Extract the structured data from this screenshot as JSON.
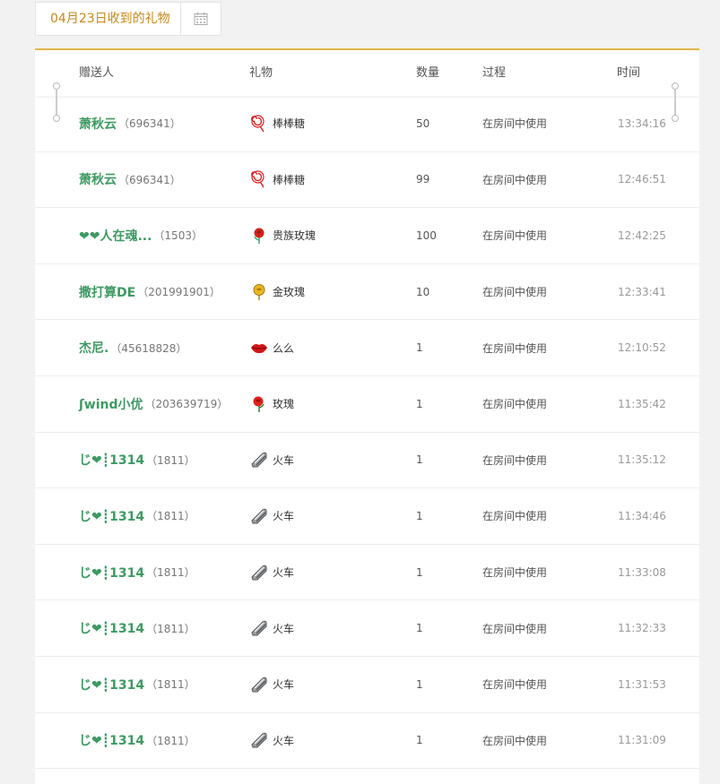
{
  "date_picker": {
    "label": "04月23日收到的礼物"
  },
  "table": {
    "headers": {
      "sender": "赠送人",
      "gift": "礼物",
      "quantity": "数量",
      "process": "过程",
      "time": "时间"
    },
    "rows": [
      {
        "sender_name": "萧秋云",
        "sender_id": "（696341）",
        "gift_icon": "lollipop-icon",
        "gift": "棒棒糖",
        "quantity": "50",
        "process": "在房间中使用",
        "time": "13:34:16"
      },
      {
        "sender_name": "萧秋云",
        "sender_id": "（696341）",
        "gift_icon": "lollipop-icon",
        "gift": "棒棒糖",
        "quantity": "99",
        "process": "在房间中使用",
        "time": "12:46:51"
      },
      {
        "sender_name": "❤❤人在魂...",
        "sender_id": "（1503）",
        "gift_icon": "red-rose-icon",
        "gift": "贵族玫瑰",
        "quantity": "100",
        "process": "在房间中使用",
        "time": "12:42:25"
      },
      {
        "sender_name": "撒打算DE",
        "sender_id": "（201991901）",
        "gift_icon": "gold-rose-icon",
        "gift": "金玫瑰",
        "quantity": "10",
        "process": "在房间中使用",
        "time": "12:33:41"
      },
      {
        "sender_name": "杰尼.",
        "sender_id": "（45618828）",
        "gift_icon": "lips-icon",
        "gift": "么么",
        "quantity": "1",
        "process": "在房间中使用",
        "time": "12:10:52"
      },
      {
        "sender_name": "ʃwind小优",
        "sender_id": "（203639719）",
        "gift_icon": "rose-icon",
        "gift": "玫瑰",
        "quantity": "1",
        "process": "在房间中使用",
        "time": "11:35:42"
      },
      {
        "sender_name": "じ❤┋1314",
        "sender_id": "（1811）",
        "gift_icon": "train-icon",
        "gift": "火车",
        "quantity": "1",
        "process": "在房间中使用",
        "time": "11:35:12"
      },
      {
        "sender_name": "じ❤┋1314",
        "sender_id": "（1811）",
        "gift_icon": "train-icon",
        "gift": "火车",
        "quantity": "1",
        "process": "在房间中使用",
        "time": "11:34:46"
      },
      {
        "sender_name": "じ❤┋1314",
        "sender_id": "（1811）",
        "gift_icon": "train-icon",
        "gift": "火车",
        "quantity": "1",
        "process": "在房间中使用",
        "time": "11:33:08"
      },
      {
        "sender_name": "じ❤┋1314",
        "sender_id": "（1811）",
        "gift_icon": "train-icon",
        "gift": "火车",
        "quantity": "1",
        "process": "在房间中使用",
        "time": "11:32:33"
      },
      {
        "sender_name": "じ❤┋1314",
        "sender_id": "（1811）",
        "gift_icon": "train-icon",
        "gift": "火车",
        "quantity": "1",
        "process": "在房间中使用",
        "time": "11:31:53"
      },
      {
        "sender_name": "じ❤┋1314",
        "sender_id": "（1811）",
        "gift_icon": "train-icon",
        "gift": "火车",
        "quantity": "1",
        "process": "在房间中使用",
        "time": "11:31:09"
      }
    ]
  },
  "colors": {
    "accent": "#e0b54a",
    "date_text": "#c8891a",
    "sender": "#3d9a62"
  }
}
